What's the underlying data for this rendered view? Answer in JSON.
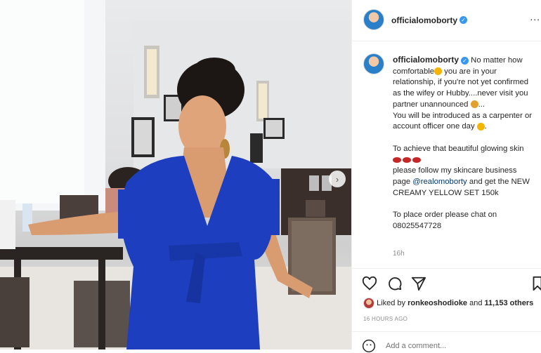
{
  "post": {
    "username": "officialomoborty",
    "more_label": "...",
    "caption": {
      "line1": "No matter how comfortable",
      "line2": " you are in your relationship, if you're not yet confirmed as the wifey or Hubby....never visit you partner unannounced ",
      "line3": "...",
      "line4": "You will be introduced as a carpenter or account officer one day ",
      "line5": ".",
      "line6": "To achieve that beautiful glowing skin",
      "line7a": "please follow my skincare business page ",
      "mention": "@realomoborty",
      "line7b": " and get the NEW CREAMY YELLOW SET 150k",
      "line8": "To place order please chat on 08025547728"
    },
    "time": "16h",
    "liked_by_prefix": "Liked by ",
    "liked_by_user": "ronkeoshodioke",
    "liked_by_mid": " and ",
    "liked_by_count": "11,153 others",
    "ago": "16 HOURS AGO",
    "comment_placeholder": "Add a comment..."
  },
  "colors": {
    "accent": "#3897f0",
    "dress": "#1d3fbf"
  },
  "icons": [
    "heart-icon",
    "comment-icon",
    "share-icon",
    "bookmark-icon",
    "verified-icon",
    "chevron-right-icon",
    "emoji-icon"
  ]
}
